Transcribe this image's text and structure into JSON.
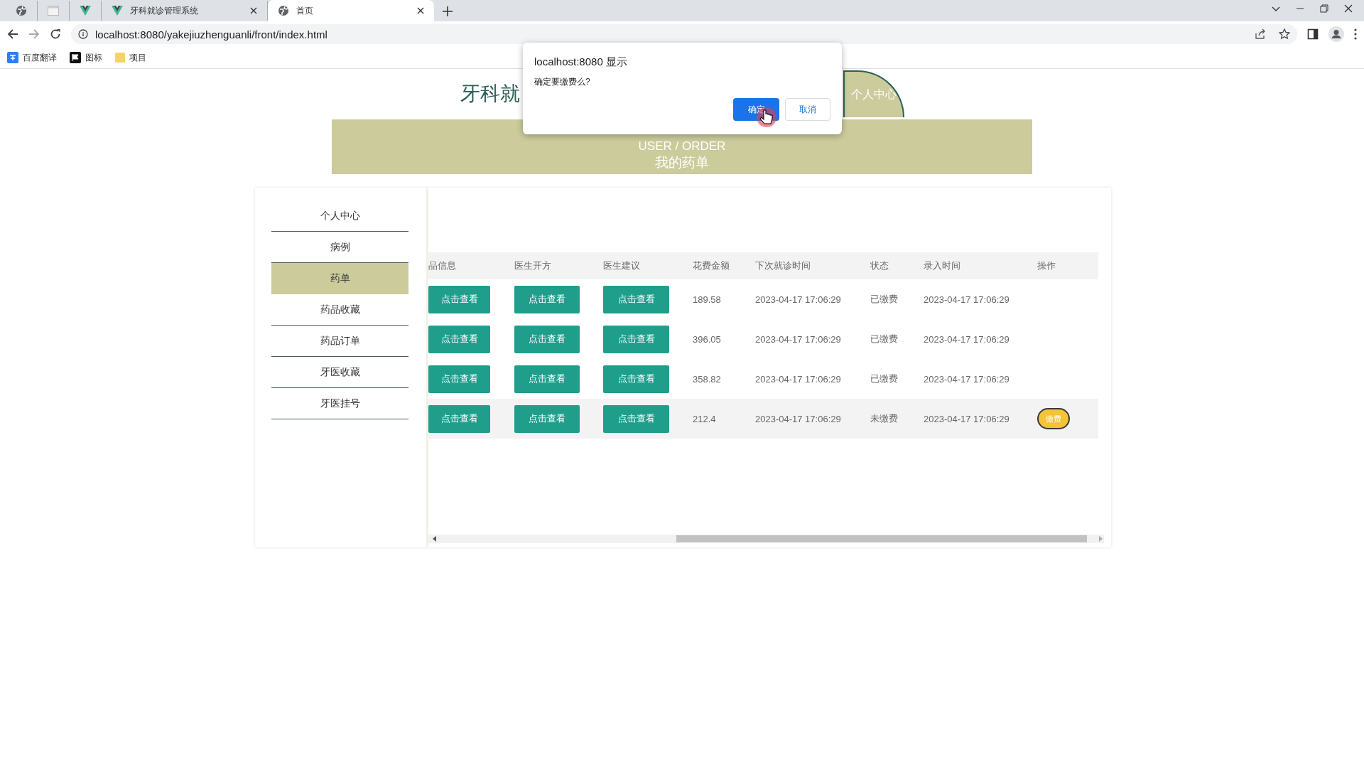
{
  "browser": {
    "tabs": [
      {
        "kind": "globe",
        "selected": false
      },
      {
        "kind": "blank",
        "selected": false
      },
      {
        "kind": "vue",
        "selected": false
      },
      {
        "kind": "vue",
        "title": "牙科就诊管理系统",
        "selected": false
      },
      {
        "kind": "globe",
        "title": "首页",
        "selected": true
      }
    ],
    "address": "localhost:8080/yakejiuzhenguanli/front/index.html",
    "bookmarks": [
      {
        "kind": "translate",
        "label": "百度翻译"
      },
      {
        "kind": "flag",
        "label": "图标"
      },
      {
        "kind": "folder",
        "label": "项目"
      }
    ]
  },
  "header": {
    "title": "牙科就",
    "profile_button": "个人中心"
  },
  "banner": {
    "subtitle": "USER / ORDER",
    "title": "我的药单"
  },
  "sidebar": {
    "items": [
      {
        "label": "个人中心",
        "selected": false
      },
      {
        "label": "病例",
        "selected": false
      },
      {
        "label": "药单",
        "selected": true
      },
      {
        "label": "药品收藏",
        "selected": false
      },
      {
        "label": "药品订单",
        "selected": false
      },
      {
        "label": "牙医收藏",
        "selected": false
      },
      {
        "label": "牙医挂号",
        "selected": false
      }
    ]
  },
  "table": {
    "columns": [
      "品信息",
      "医生开方",
      "医生建议",
      "花费金额",
      "下次就诊时间",
      "状态",
      "录入时间",
      "操作"
    ],
    "rows": [
      {
        "medicine": "点击查看",
        "prescription": "点击查看",
        "advice": "点击查看",
        "amount": "189.58",
        "next_visit": "2023-04-17 17:06:29",
        "status": "已缴费",
        "entered": "2023-04-17 17:06:29",
        "hovered": false
      },
      {
        "medicine": "点击查看",
        "prescription": "点击查看",
        "advice": "点击查看",
        "amount": "396.05",
        "next_visit": "2023-04-17 17:06:29",
        "status": "已缴费",
        "entered": "2023-04-17 17:06:29",
        "hovered": false
      },
      {
        "medicine": "点击查看",
        "prescription": "点击查看",
        "advice": "点击查看",
        "amount": "358.82",
        "next_visit": "2023-04-17 17:06:29",
        "status": "已缴费",
        "entered": "2023-04-17 17:06:29",
        "hovered": false
      },
      {
        "medicine": "点击查看",
        "prescription": "点击查看",
        "advice": "点击查看",
        "amount": "212.4",
        "next_visit": "2023-04-17 17:06:29",
        "status": "未缴费",
        "entered": "2023-04-17 17:06:29",
        "action": "缴费",
        "hovered": true
      }
    ]
  },
  "dialog": {
    "title": "localhost:8080 显示",
    "message": "确定要缴费么?",
    "confirm": "确定",
    "cancel": "取消"
  }
}
